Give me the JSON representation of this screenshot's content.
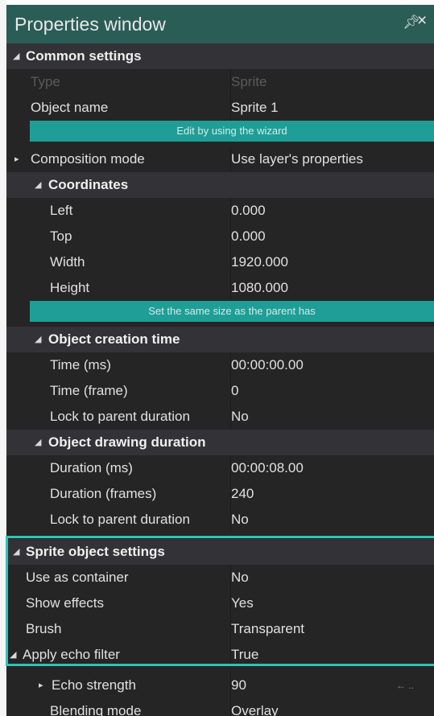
{
  "window": {
    "title": "Properties window",
    "pin_glyph": "↕",
    "close_glyph": "×"
  },
  "common": {
    "label": "Common settings",
    "type_name": "Type",
    "type_value": "Sprite",
    "object_name": "Object name",
    "object_value": "Sprite 1",
    "wizard_label": "Edit by using the wizard",
    "composition_name": "Composition mode",
    "composition_value": "Use layer's properties"
  },
  "coordinates": {
    "label": "Coordinates",
    "rows": [
      {
        "name": "Left",
        "value": "0.000"
      },
      {
        "name": "Top",
        "value": "0.000"
      },
      {
        "name": "Width",
        "value": "1920.000"
      },
      {
        "name": "Height",
        "value": "1080.000"
      }
    ],
    "parent_size_label": "Set the same size as the parent has"
  },
  "creation_time": {
    "label": "Object creation time",
    "rows": [
      {
        "name": "Time (ms)",
        "value": "00:00:00.00"
      },
      {
        "name": "Time (frame)",
        "value": "0"
      },
      {
        "name": "Lock to parent duration",
        "value": "No"
      }
    ]
  },
  "drawing_duration": {
    "label": "Object drawing duration",
    "rows": [
      {
        "name": "Duration (ms)",
        "value": "00:00:08.00"
      },
      {
        "name": "Duration (frames)",
        "value": "240"
      },
      {
        "name": "Lock to parent duration",
        "value": "No"
      }
    ]
  },
  "sprite_settings": {
    "label": "Sprite object settings",
    "rows": [
      {
        "name": "Use as container",
        "value": "No"
      },
      {
        "name": "Show effects",
        "value": "Yes"
      },
      {
        "name": "Brush",
        "value": "Transparent"
      }
    ],
    "echo_name": "Apply echo filter",
    "echo_value": "True",
    "echo_strength_name": "Echo strength",
    "echo_strength_value": "90",
    "blending_name": "Blending mode",
    "blending_value": "Overlay"
  },
  "colors": {
    "title_bar": "#2b5d57",
    "wizard_button": "#1f9e97",
    "highlight": "#2ec4b6",
    "panel": "#252526"
  },
  "icons": [
    "pin-icon",
    "close-icon",
    "expanded-triangle-icon",
    "collapsed-triangle-icon"
  ]
}
